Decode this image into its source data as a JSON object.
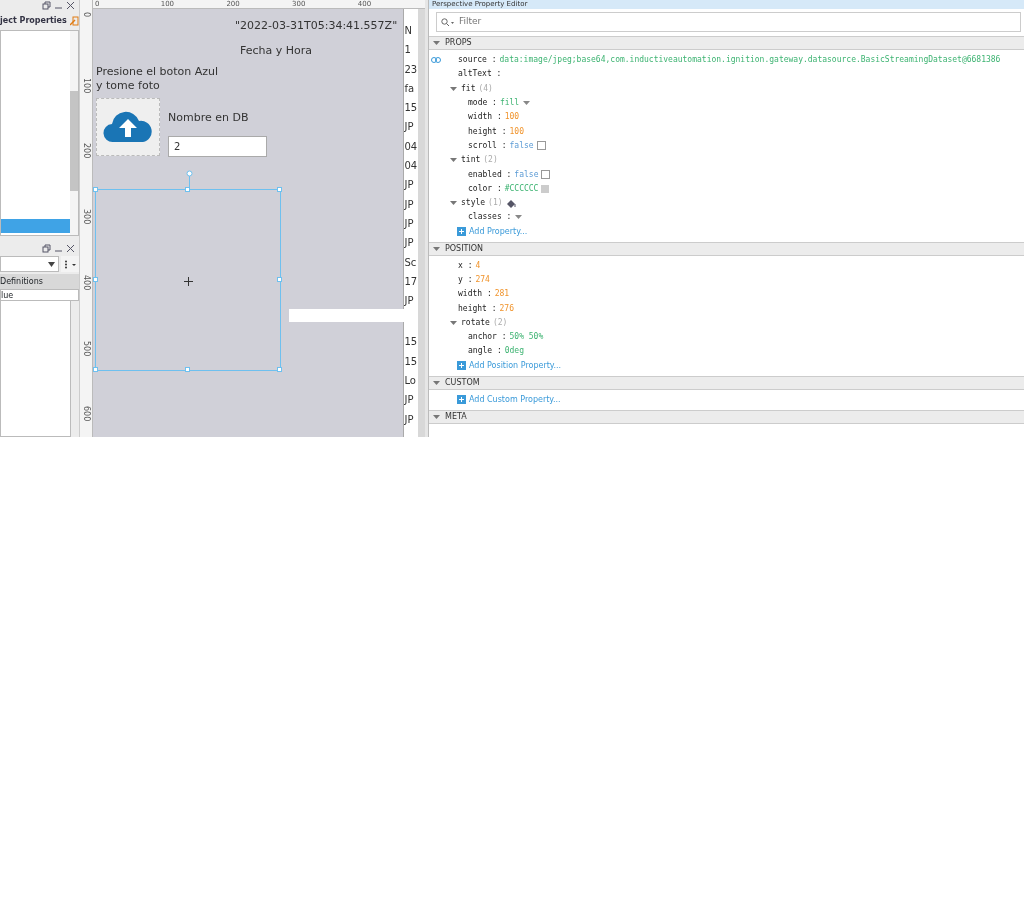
{
  "left_panel": {
    "title": "ject Properties",
    "selected_row": true,
    "definitions": {
      "tab": "Definitions",
      "column": "lue"
    }
  },
  "rulers": {
    "horizontal": [
      "0",
      "100",
      "200",
      "300",
      "400"
    ],
    "vertical": [
      "0",
      "100",
      "200",
      "300",
      "400",
      "500",
      "600"
    ]
  },
  "canvas": {
    "timestamp": "\"2022-03-31T05:34:41.557Z\"",
    "date_label": "Fecha y Hora",
    "instructions": "Presione el boton Azul y tome foto",
    "name_label": "Nombre en DB",
    "name_field": {
      "value": "2"
    },
    "image_selected": true
  },
  "table_column": [
    "N",
    "1",
    "23",
    "fa",
    "15",
    "JP",
    "04",
    "04",
    "JP",
    "JP",
    "JP",
    "JP",
    "Sc",
    "17",
    "JP",
    "15",
    "15",
    "Lo",
    "JP",
    "JP"
  ],
  "property_editor": {
    "title": "Perspective Property Editor",
    "filter": {
      "placeholder": "Filter"
    },
    "sections": [
      {
        "name": "PROPS",
        "expanded": true,
        "add_link": "Add Property...",
        "properties": [
          {
            "key": "source :",
            "value": "data:image/jpeg;base64,com.inductiveautomation.ignition.gateway.datasource.BasicStreamingDataset@6681386",
            "kind": "string",
            "bound": true
          },
          {
            "key": "altText :",
            "kind": "string"
          },
          {
            "key": "fit",
            "count": "(4)",
            "kind": "object",
            "expanded": true,
            "children": [
              {
                "key": "mode :",
                "value": "fill",
                "kind": "enum"
              },
              {
                "key": "width :",
                "value": "100",
                "kind": "number"
              },
              {
                "key": "height :",
                "value": "100",
                "kind": "number"
              },
              {
                "key": "scroll :",
                "value": "false",
                "kind": "boolean",
                "checked": false
              }
            ]
          },
          {
            "key": "tint",
            "count": "(2)",
            "kind": "object",
            "expanded": true,
            "children": [
              {
                "key": "enabled :",
                "value": "false",
                "kind": "boolean",
                "checked": false
              },
              {
                "key": "color :",
                "value": "#CCCCCC",
                "kind": "color",
                "color": "#cccccc"
              }
            ]
          },
          {
            "key": "style",
            "count": "(1)",
            "kind": "object",
            "expanded": true,
            "style_icon": true,
            "children": [
              {
                "key": "classes :",
                "kind": "enum"
              }
            ]
          }
        ]
      },
      {
        "name": "POSITION",
        "expanded": true,
        "add_link": "Add Position Property...",
        "properties": [
          {
            "key": "x :",
            "value": "4",
            "kind": "number"
          },
          {
            "key": "y :",
            "value": "274",
            "kind": "number"
          },
          {
            "key": "width :",
            "value": "281",
            "kind": "number"
          },
          {
            "key": "height :",
            "value": "276",
            "kind": "number"
          },
          {
            "key": "rotate",
            "count": "(2)",
            "kind": "object",
            "expanded": true,
            "children": [
              {
                "key": "anchor :",
                "value": "50% 50%",
                "kind": "string"
              },
              {
                "key": "angle :",
                "value": "0deg",
                "kind": "string"
              }
            ]
          }
        ]
      },
      {
        "name": "CUSTOM",
        "expanded": true,
        "add_link": "Add Custom Property..."
      },
      {
        "name": "META",
        "expanded": true
      }
    ]
  }
}
